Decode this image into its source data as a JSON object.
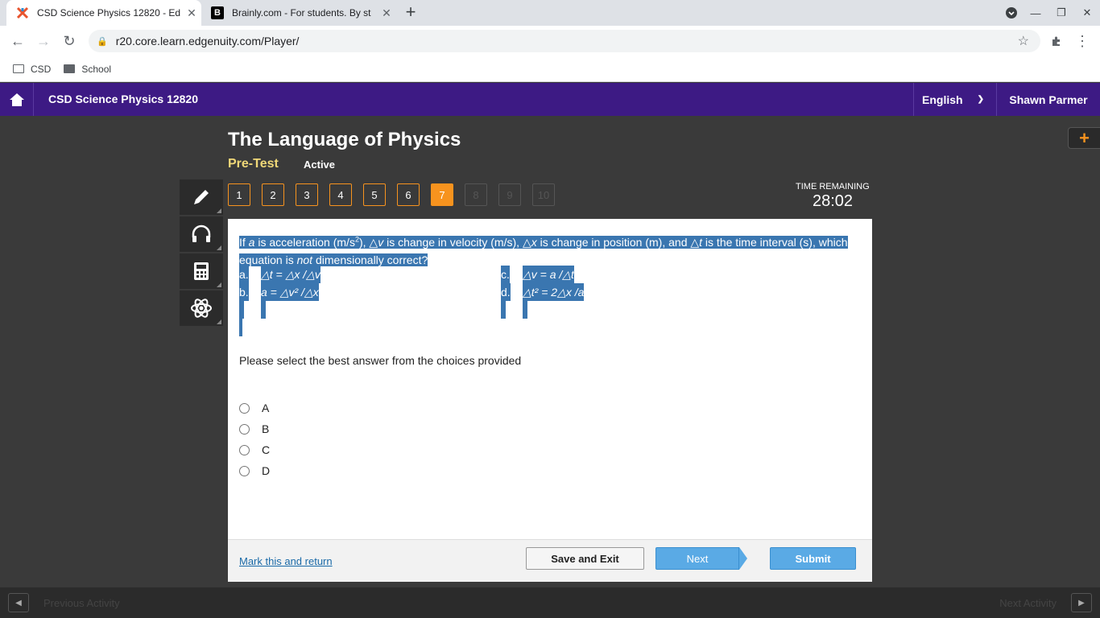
{
  "browser": {
    "tabs": [
      {
        "title": "CSD Science Physics 12820 - Ed",
        "active": true
      },
      {
        "title": "Brainly.com - For students. By st",
        "active": false
      }
    ],
    "url": "r20.core.learn.edgenuity.com/Player/",
    "bookmarks": [
      "CSD",
      "School"
    ]
  },
  "header": {
    "course": "CSD Science Physics 12820",
    "language": "English",
    "user": "Shawn Parmer"
  },
  "activity": {
    "title": "The Language of Physics",
    "type": "Pre-Test",
    "status": "Active"
  },
  "questions": {
    "numbers": [
      "1",
      "2",
      "3",
      "4",
      "5",
      "6",
      "7",
      "8",
      "9",
      "10"
    ],
    "current": "7"
  },
  "timer": {
    "label": "TIME REMAINING",
    "value": "28:02"
  },
  "question": {
    "p1": "If ",
    "a": "a",
    "p2": " is acceleration (m/s",
    "sq": "2",
    "p3": "), ",
    "p4": "v",
    "p5": " is change in velocity (m/s), ",
    "p6": "x",
    "p7": " is change in position (m), and ",
    "p8": "t",
    "p9": " is the time interval (s), which equation is ",
    "not": "not",
    "p10": " dimensionally correct?",
    "options": [
      {
        "letter": "a.",
        "eq": "△t = △x /△v"
      },
      {
        "letter": "b.",
        "eq": "a = △v² /△x"
      },
      {
        "letter": "c.",
        "eq": "△v = a /△t"
      },
      {
        "letter": "d.",
        "eq": "△t² = 2△x /a"
      }
    ]
  },
  "prompt": "Please select the best answer from the choices provided",
  "answers": [
    "A",
    "B",
    "C",
    "D"
  ],
  "footer": {
    "mark": "Mark this and return",
    "save": "Save and Exit",
    "next": "Next",
    "submit": "Submit"
  },
  "bottom": {
    "prev": "Previous Activity",
    "next": "Next Activity"
  },
  "colors": {
    "brand": "#3d1a84",
    "accent": "#f7931e",
    "button": "#5aaae5"
  }
}
